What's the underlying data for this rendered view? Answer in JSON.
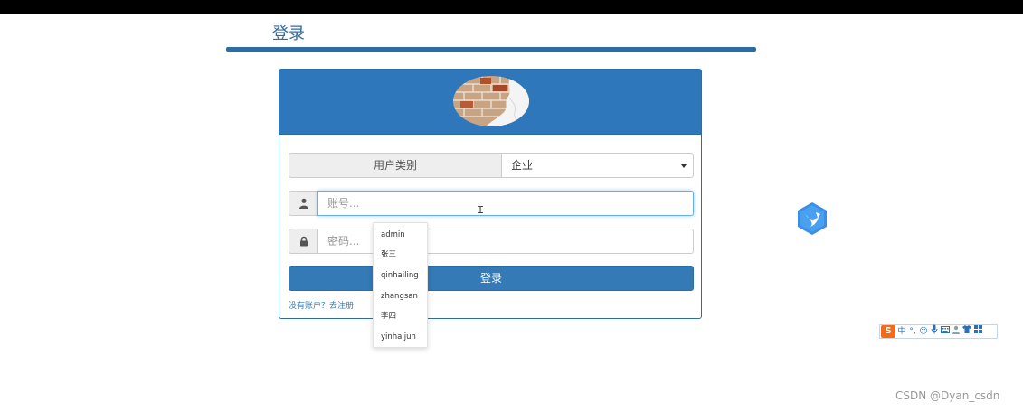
{
  "page": {
    "title": "登录"
  },
  "form": {
    "user_type_label": "用户类别",
    "user_type_value": "企业",
    "account_placeholder": "账号...",
    "password_placeholder": "密码...",
    "login_button": "登录",
    "register_link": "没有账户？去注册"
  },
  "autocomplete": {
    "options": [
      "admin",
      "张三",
      "qinhailing",
      "zhangsan",
      "李四",
      "yinhaijun"
    ]
  },
  "colors": {
    "primary": "#337ab7",
    "header": "#2e77bb",
    "ime_orange": "#f26b1d"
  },
  "ime_toolbar": {
    "logo": "S",
    "items": [
      "中",
      "°,",
      "☺",
      "mic-icon",
      "keyboard-icon",
      "user-icon",
      "shirt-icon",
      "grid-icon"
    ]
  },
  "watermark": "CSDN @Dyan_csdn"
}
